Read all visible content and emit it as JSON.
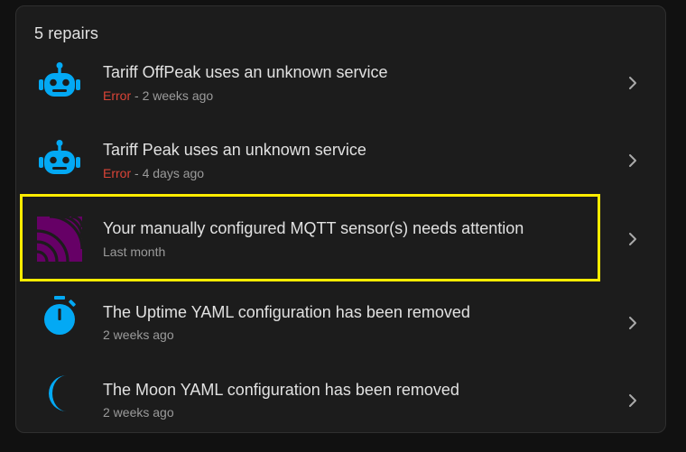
{
  "header": {
    "title": "5 repairs"
  },
  "repairs": [
    {
      "icon": "robot-icon",
      "title": "Tariff OffPeak uses an unknown service",
      "severity": "Error",
      "separator": " - ",
      "time": "2 weeks ago"
    },
    {
      "icon": "robot-icon",
      "title": "Tariff Peak uses an unknown service",
      "severity": "Error",
      "separator": " - ",
      "time": "4 days ago"
    },
    {
      "icon": "mqtt-logo-icon",
      "title": "Your manually configured MQTT sensor(s) needs attention",
      "time": "Last month"
    },
    {
      "icon": "timer-icon",
      "title": "The Uptime YAML configuration has been removed",
      "time": "2 weeks ago"
    },
    {
      "icon": "moon-icon",
      "title": "The Moon YAML configuration has been removed",
      "time": "2 weeks ago"
    }
  ],
  "colors": {
    "icon_blue": "#03a9f4",
    "error_red": "#db4437",
    "mqtt_purple": "#660066",
    "highlight_yellow": "#ffec00"
  }
}
